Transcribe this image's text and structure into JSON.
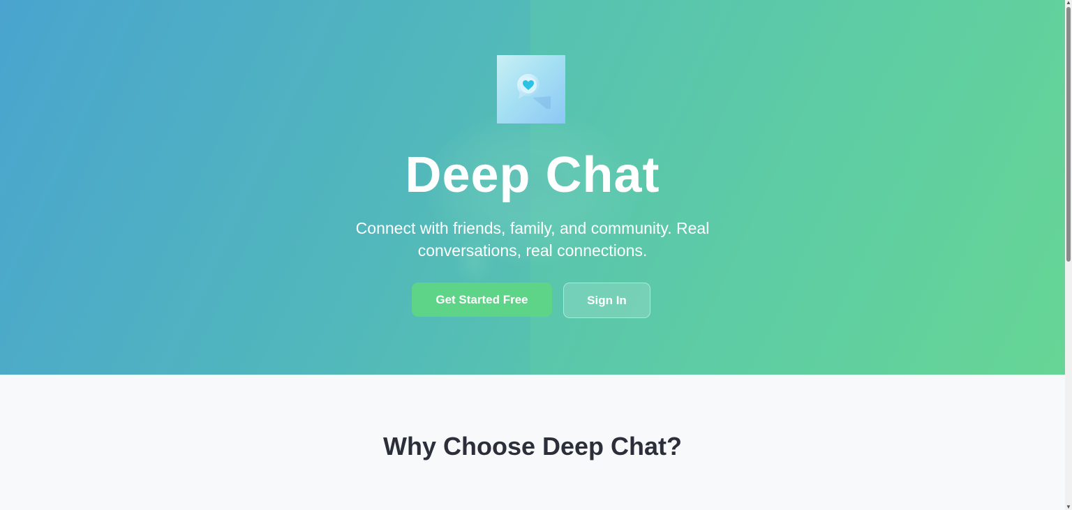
{
  "hero": {
    "title": "Deep Chat",
    "subtitle": "Connect with friends, family, and community. Real conversations, real connections.",
    "primary_button": "Get Started Free",
    "secondary_button": "Sign In",
    "logo_icon": "chat-heart-icon"
  },
  "features": {
    "title": "Why Choose Deep Chat?"
  },
  "colors": {
    "hero_gradient_start": "#4aa4cf",
    "hero_gradient_end": "#66d594",
    "primary_button": "#5dd487",
    "section_background": "#f7f9fb",
    "heading_text": "#2b2f3a"
  }
}
